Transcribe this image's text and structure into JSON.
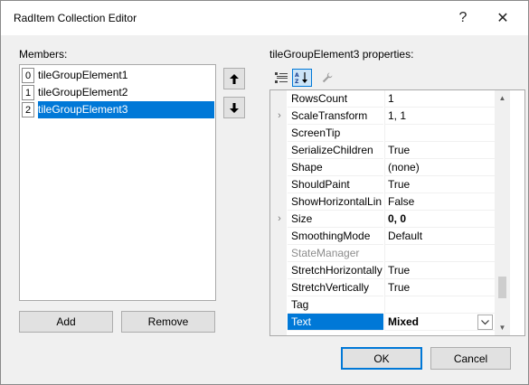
{
  "window": {
    "title": "RadItem Collection Editor",
    "help_glyph": "?",
    "close_glyph": "✕"
  },
  "members": {
    "label": "Members:",
    "items": [
      {
        "index": "0",
        "name": "tileGroupElement1",
        "selected": false
      },
      {
        "index": "1",
        "name": "tileGroupElement2",
        "selected": false
      },
      {
        "index": "2",
        "name": "tileGroupElement3",
        "selected": true
      }
    ],
    "add_label": "Add",
    "remove_label": "Remove"
  },
  "properties": {
    "label": "tileGroupElement3 properties:",
    "rows": [
      {
        "name": "RowsCount",
        "value": "1",
        "expandable": false,
        "disabled": false,
        "bold": false,
        "selected": false
      },
      {
        "name": "ScaleTransform",
        "value": "1, 1",
        "expandable": true,
        "disabled": false,
        "bold": false,
        "selected": false
      },
      {
        "name": "ScreenTip",
        "value": "",
        "expandable": false,
        "disabled": false,
        "bold": false,
        "selected": false
      },
      {
        "name": "SerializeChildren",
        "value": "True",
        "expandable": false,
        "disabled": false,
        "bold": false,
        "selected": false
      },
      {
        "name": "Shape",
        "value": "(none)",
        "expandable": false,
        "disabled": false,
        "bold": false,
        "selected": false
      },
      {
        "name": "ShouldPaint",
        "value": "True",
        "expandable": false,
        "disabled": false,
        "bold": false,
        "selected": false
      },
      {
        "name": "ShowHorizontalLin",
        "value": "False",
        "expandable": false,
        "disabled": false,
        "bold": false,
        "selected": false
      },
      {
        "name": "Size",
        "value": "0, 0",
        "expandable": true,
        "disabled": false,
        "bold": true,
        "selected": false
      },
      {
        "name": "SmoothingMode",
        "value": "Default",
        "expandable": false,
        "disabled": false,
        "bold": false,
        "selected": false
      },
      {
        "name": "StateManager",
        "value": "",
        "expandable": false,
        "disabled": true,
        "bold": false,
        "selected": false
      },
      {
        "name": "StretchHorizontally",
        "value": "True",
        "expandable": false,
        "disabled": false,
        "bold": false,
        "selected": false
      },
      {
        "name": "StretchVertically",
        "value": "True",
        "expandable": false,
        "disabled": false,
        "bold": false,
        "selected": false
      },
      {
        "name": "Tag",
        "value": "",
        "expandable": false,
        "disabled": false,
        "bold": false,
        "selected": false
      },
      {
        "name": "Text",
        "value": "Mixed",
        "expandable": false,
        "disabled": false,
        "bold": true,
        "selected": true
      }
    ]
  },
  "footer": {
    "ok_label": "OK",
    "cancel_label": "Cancel"
  },
  "colors": {
    "selection": "#0078d7",
    "window_bg": "#f0f0f0",
    "button_bg": "#e1e1e1"
  },
  "icons": {
    "categorized": "categorized-view-icon",
    "alphabetical": "alphabetical-sort-icon",
    "property_pages": "wrench-icon",
    "move_up": "arrow-up-icon",
    "move_down": "arrow-down-icon"
  }
}
